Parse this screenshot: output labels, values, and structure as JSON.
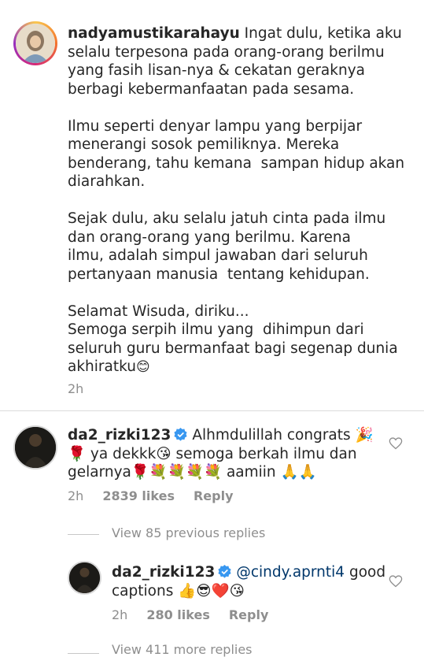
{
  "caption": {
    "username": "nadyamustikarahayu",
    "text_first": " Ingat dulu, ketika aku\nselalu terpesona pada orang-orang berilmu\nyang fasih lisan-nya & cekatan geraknya\nberbagi kebermanfaatan pada sesama.\n\nIlmu seperti denyar lampu yang berpijar\nmenerangi sosok pemiliknya. Mereka\nbenderang, tahu kemana  sampan hidup akan\ndiarahkan.\n\nSejak dulu, aku selalu jatuh cinta pada ilmu\ndan orang-orang yang berilmu. Karena\nilmu, adalah simpul jawaban dari seluruh\npertanyaan manusia  tentang kehidupan.\n\nSelamat Wisuda, diriku...\nSemoga serpih ilmu yang  dihimpun dari\nseluruh guru bermanfaat bagi segenap dunia\nakhiratku",
    "emoji_end": "😊",
    "time": "2h"
  },
  "comment1": {
    "username": "da2_rizki123",
    "text": "Alhmdulillah congrats 🎉\n🌹 ya dekkk😘 semoga berkah ilmu dan\ngelarnya🌹💐💐💐💐 aamiin 🙏🙏",
    "time": "2h",
    "likes": "2839 likes",
    "reply": "Reply"
  },
  "view_replies": "View 85 previous replies",
  "reply1": {
    "username": "da2_rizki123",
    "mention": "@cindy.aprnti4",
    "text_after": " good\ncaptions 👍😎❤️😘",
    "time": "2h",
    "likes": "280 likes",
    "reply": "Reply"
  },
  "view_more": "View 411 more replies",
  "colors": {
    "text": "#262626",
    "meta": "#8e8e8e",
    "mention": "#00376b",
    "verified": "#3897f0",
    "divider": "#dbdbdb"
  }
}
